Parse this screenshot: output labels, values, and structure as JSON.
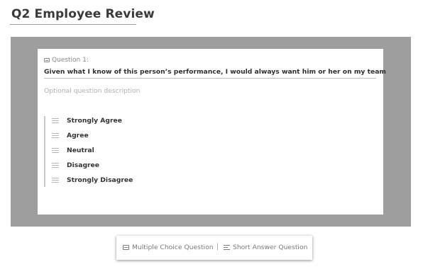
{
  "page": {
    "title": "Q2 Employee Review"
  },
  "question": {
    "label": "Question 1:",
    "label_icon": "form-icon",
    "text": "Given what I know of this person’s performance, I would always want him or her on my team",
    "description_placeholder": "Optional question description"
  },
  "options": [
    {
      "label": "Strongly Agree",
      "icon": "drag-handle-icon"
    },
    {
      "label": "Agree",
      "icon": "drag-handle-icon"
    },
    {
      "label": "Neutral",
      "icon": "drag-handle-icon"
    },
    {
      "label": "Disagree",
      "icon": "drag-handle-icon"
    },
    {
      "label": "Strongly Disagree",
      "icon": "drag-handle-icon"
    }
  ],
  "toolbar": {
    "multiple_choice_label": "Multiple Choice Question",
    "multiple_choice_icon": "multiple-choice-icon",
    "separator": "|",
    "short_answer_label": "Short Answer Question",
    "short_answer_icon": "short-answer-icon"
  },
  "colors": {
    "canvas_background": "#9e9e9e",
    "card_background": "#ffffff",
    "text_primary": "#333333",
    "text_muted": "#8a8a8a"
  }
}
